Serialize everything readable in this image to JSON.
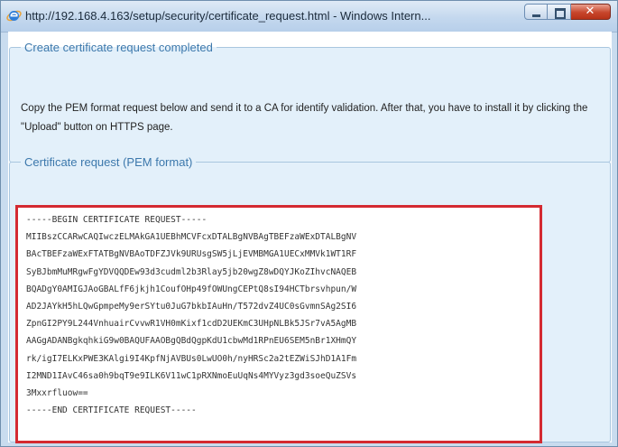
{
  "window": {
    "title": "http://192.168.4.163/setup/security/certificate_request.html - Windows Intern...",
    "close_glyph": "✕"
  },
  "panel_completed": {
    "legend": "Create certificate request completed",
    "description": "Copy the PEM format request below and send it to a CA for identify validation. After that, you have to install it by clicking the \"Upload\" button on HTTPS page."
  },
  "panel_request": {
    "legend": "Certificate request (PEM format)",
    "lines": [
      "-----BEGIN CERTIFICATE REQUEST-----",
      "MIIBszCCARwCAQIwczELMAkGA1UEBhMCVFcxDTALBgNVBAgTBEFzaWExDTALBgNV",
      "BAcTBEFzaWExFTATBgNVBAoTDFZJVk9URUsgSW5jLjEVMBMGA1UECxMMVk1WT1RF",
      "SyBJbmMuMRgwFgYDVQQDEw93d3cudml2b3Rlay5jb20wgZ8wDQYJKoZIhvcNAQEB",
      "BQADgY0AMIGJAoGBALfF6jkjh1CoufOHp49fOWUngCEPtQ8sI94HCTbrsvhpun/W",
      "AD2JAYkH5hLQwGpmpeMy9erSYtu0JuG7bkbIAuHn/T572dvZ4UC0sGvmnSAg2SI6",
      "ZpnGI2PY9L244VnhuairCvvwR1VH0mKixf1cdD2UEKmC3UHpNLBk5JSr7vA5AgMB",
      "AAGgADANBgkqhkiG9w0BAQUFAAOBgQBdQgpKdU1cbwMd1RPnEU6SEM5nBr1XHmQY",
      "rk/igI7ELKxPWE3KAlgi9I4KpfNjAVBUs0LwUO0h/nyHRSc2a2tEZWiSJhD1A1Fm",
      "I2MND1IAvC46sa0h9bqT9e9ILK6V11wC1pRXNmoEuUqNs4MYVyz3gd3soeQuZSVs",
      "3Mxxrfluow==",
      "-----END CERTIFICATE REQUEST-----"
    ]
  }
}
